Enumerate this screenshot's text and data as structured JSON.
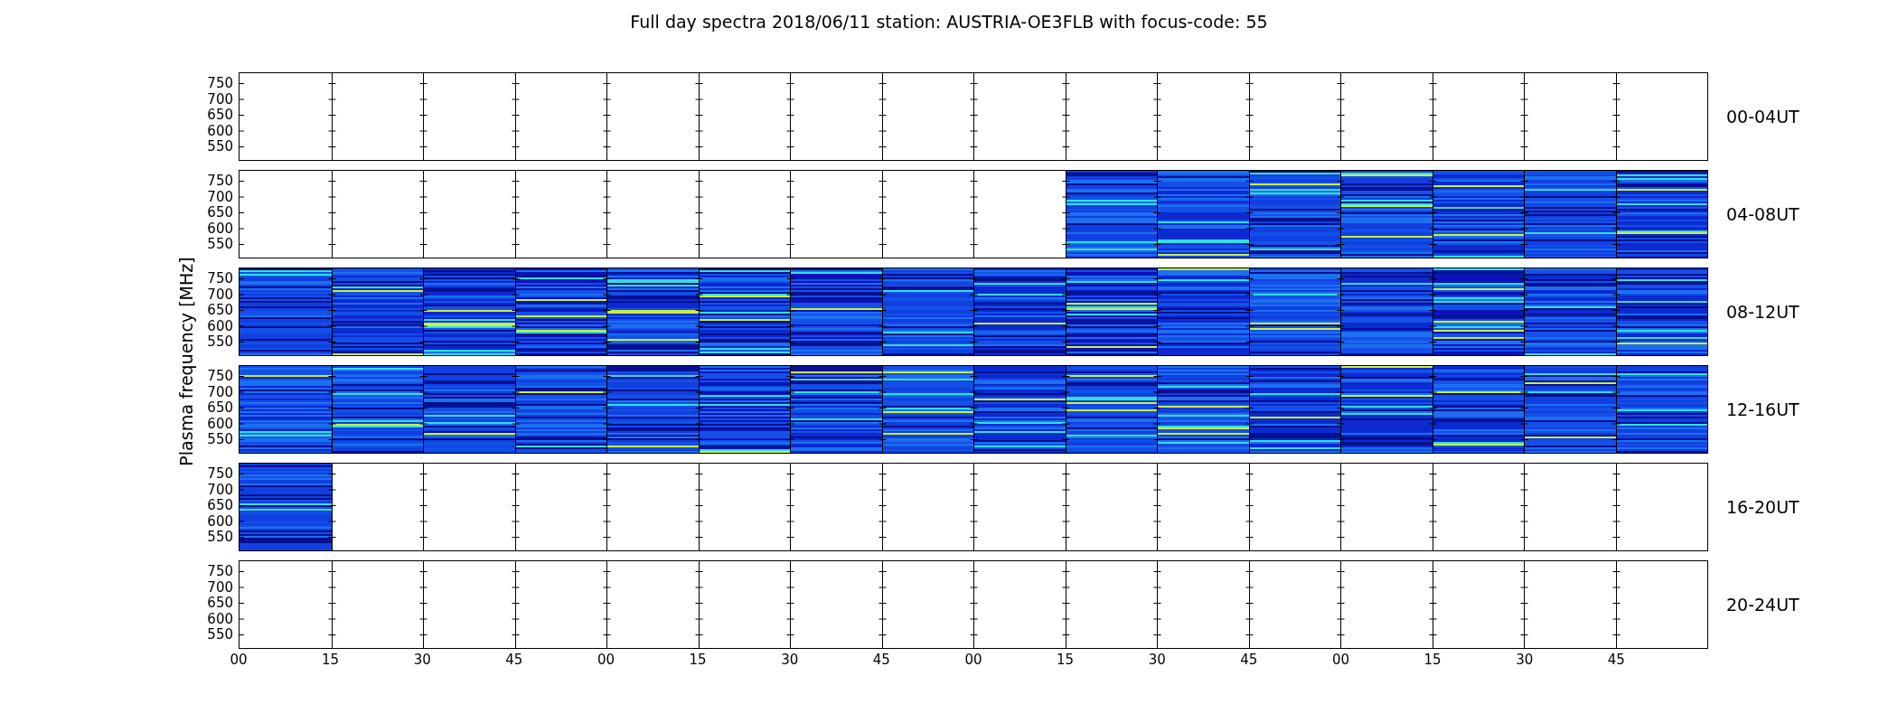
{
  "title": "Full day spectra 2018/06/11 station: AUSTRIA-OE3FLB with focus-code: 55",
  "ylabel": "Plasma frequency [MHz]",
  "rows": [
    {
      "label": "00-04UT",
      "yticks": [
        "750",
        "700",
        "650",
        "600",
        "550"
      ],
      "has_data": [
        false,
        false,
        false,
        false,
        false,
        false,
        false,
        false,
        false,
        false,
        false,
        false,
        false,
        false,
        false,
        false
      ]
    },
    {
      "label": "04-08UT",
      "yticks": [
        "750",
        "700",
        "650",
        "600",
        "550"
      ],
      "has_data": [
        false,
        false,
        false,
        false,
        false,
        false,
        false,
        false,
        false,
        true,
        true,
        true,
        true,
        true,
        true,
        true
      ]
    },
    {
      "label": "08-12UT",
      "yticks": [
        "750",
        "700",
        "650",
        "600",
        "550"
      ],
      "has_data": [
        true,
        true,
        true,
        true,
        true,
        true,
        true,
        true,
        true,
        true,
        true,
        true,
        true,
        true,
        true,
        true
      ]
    },
    {
      "label": "12-16UT",
      "yticks": [
        "750",
        "700",
        "650",
        "600",
        "550"
      ],
      "has_data": [
        true,
        true,
        true,
        true,
        true,
        true,
        true,
        true,
        true,
        true,
        true,
        true,
        true,
        true,
        true,
        true
      ]
    },
    {
      "label": "16-20UT",
      "yticks": [
        "750",
        "700",
        "650",
        "600",
        "550"
      ],
      "has_data": [
        true,
        false,
        false,
        false,
        false,
        false,
        false,
        false,
        false,
        false,
        false,
        false,
        false,
        false,
        false,
        false
      ]
    },
    {
      "label": "20-24UT",
      "yticks": [
        "750",
        "700",
        "650",
        "600",
        "550"
      ],
      "has_data": [
        false,
        false,
        false,
        false,
        false,
        false,
        false,
        false,
        false,
        false,
        false,
        false,
        false,
        false,
        false,
        false
      ]
    }
  ],
  "xticks": [
    "00",
    "15",
    "30",
    "45",
    "00",
    "15",
    "30",
    "45",
    "00",
    "15",
    "30",
    "45",
    "00",
    "15",
    "30",
    "45"
  ]
}
